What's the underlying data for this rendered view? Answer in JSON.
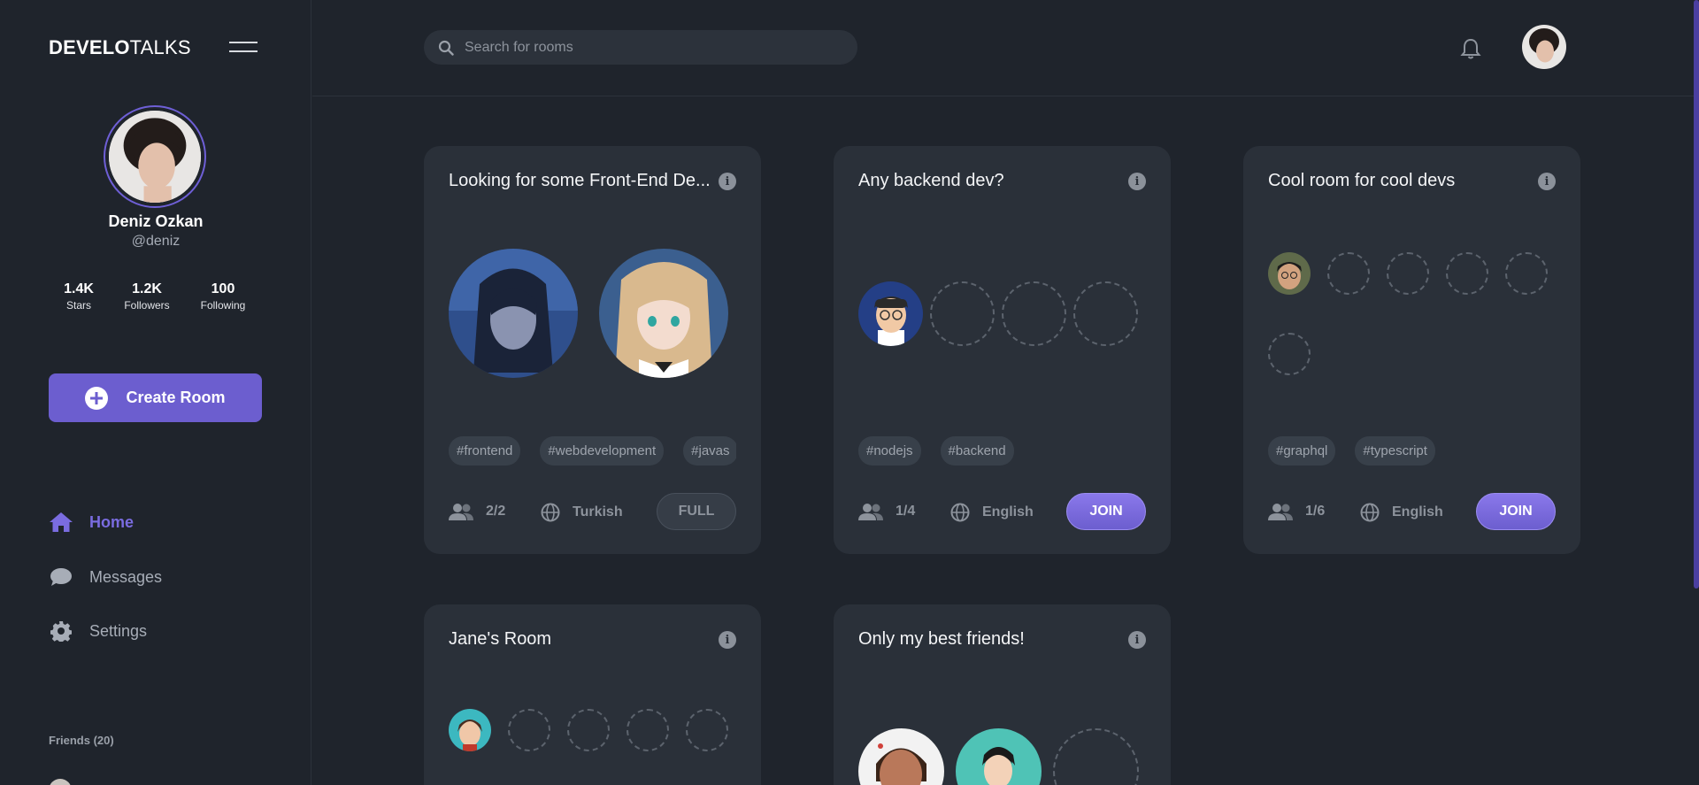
{
  "app": {
    "logo_bold": "DEVELO",
    "logo_light": "TALKS"
  },
  "profile": {
    "name": "Deniz Ozkan",
    "handle": "@deniz",
    "stats": [
      {
        "value": "1.4K",
        "label": "Stars"
      },
      {
        "value": "1.2K",
        "label": "Followers"
      },
      {
        "value": "100",
        "label": "Following"
      }
    ]
  },
  "sidebar": {
    "create_room_label": "Create Room",
    "nav": [
      {
        "label": "Home",
        "icon": "home-icon",
        "active": true
      },
      {
        "label": "Messages",
        "icon": "chat-bubble-icon",
        "active": false
      },
      {
        "label": "Settings",
        "icon": "gear-icon",
        "active": false
      }
    ],
    "friends_label": "Friends (20)"
  },
  "header": {
    "search_placeholder": "Search for rooms"
  },
  "colors": {
    "accent": "#6c5ecf",
    "background": "#1f242c",
    "card": "#2a3039"
  },
  "rooms": [
    {
      "title": "Looking for some Front-End De...",
      "tags": [
        "#frontend",
        "#webdevelopment",
        "#javas"
      ],
      "count": "2/2",
      "language": "Turkish",
      "action": "FULL"
    },
    {
      "title": "Any backend dev?",
      "tags": [
        "#nodejs",
        "#backend"
      ],
      "count": "1/4",
      "language": "English",
      "action": "JOIN"
    },
    {
      "title": "Cool room for cool devs",
      "tags": [
        "#graphql",
        "#typescript"
      ],
      "count": "1/6",
      "language": "English",
      "action": "JOIN"
    },
    {
      "title": "Jane's Room"
    },
    {
      "title": "Only my best friends!"
    }
  ]
}
